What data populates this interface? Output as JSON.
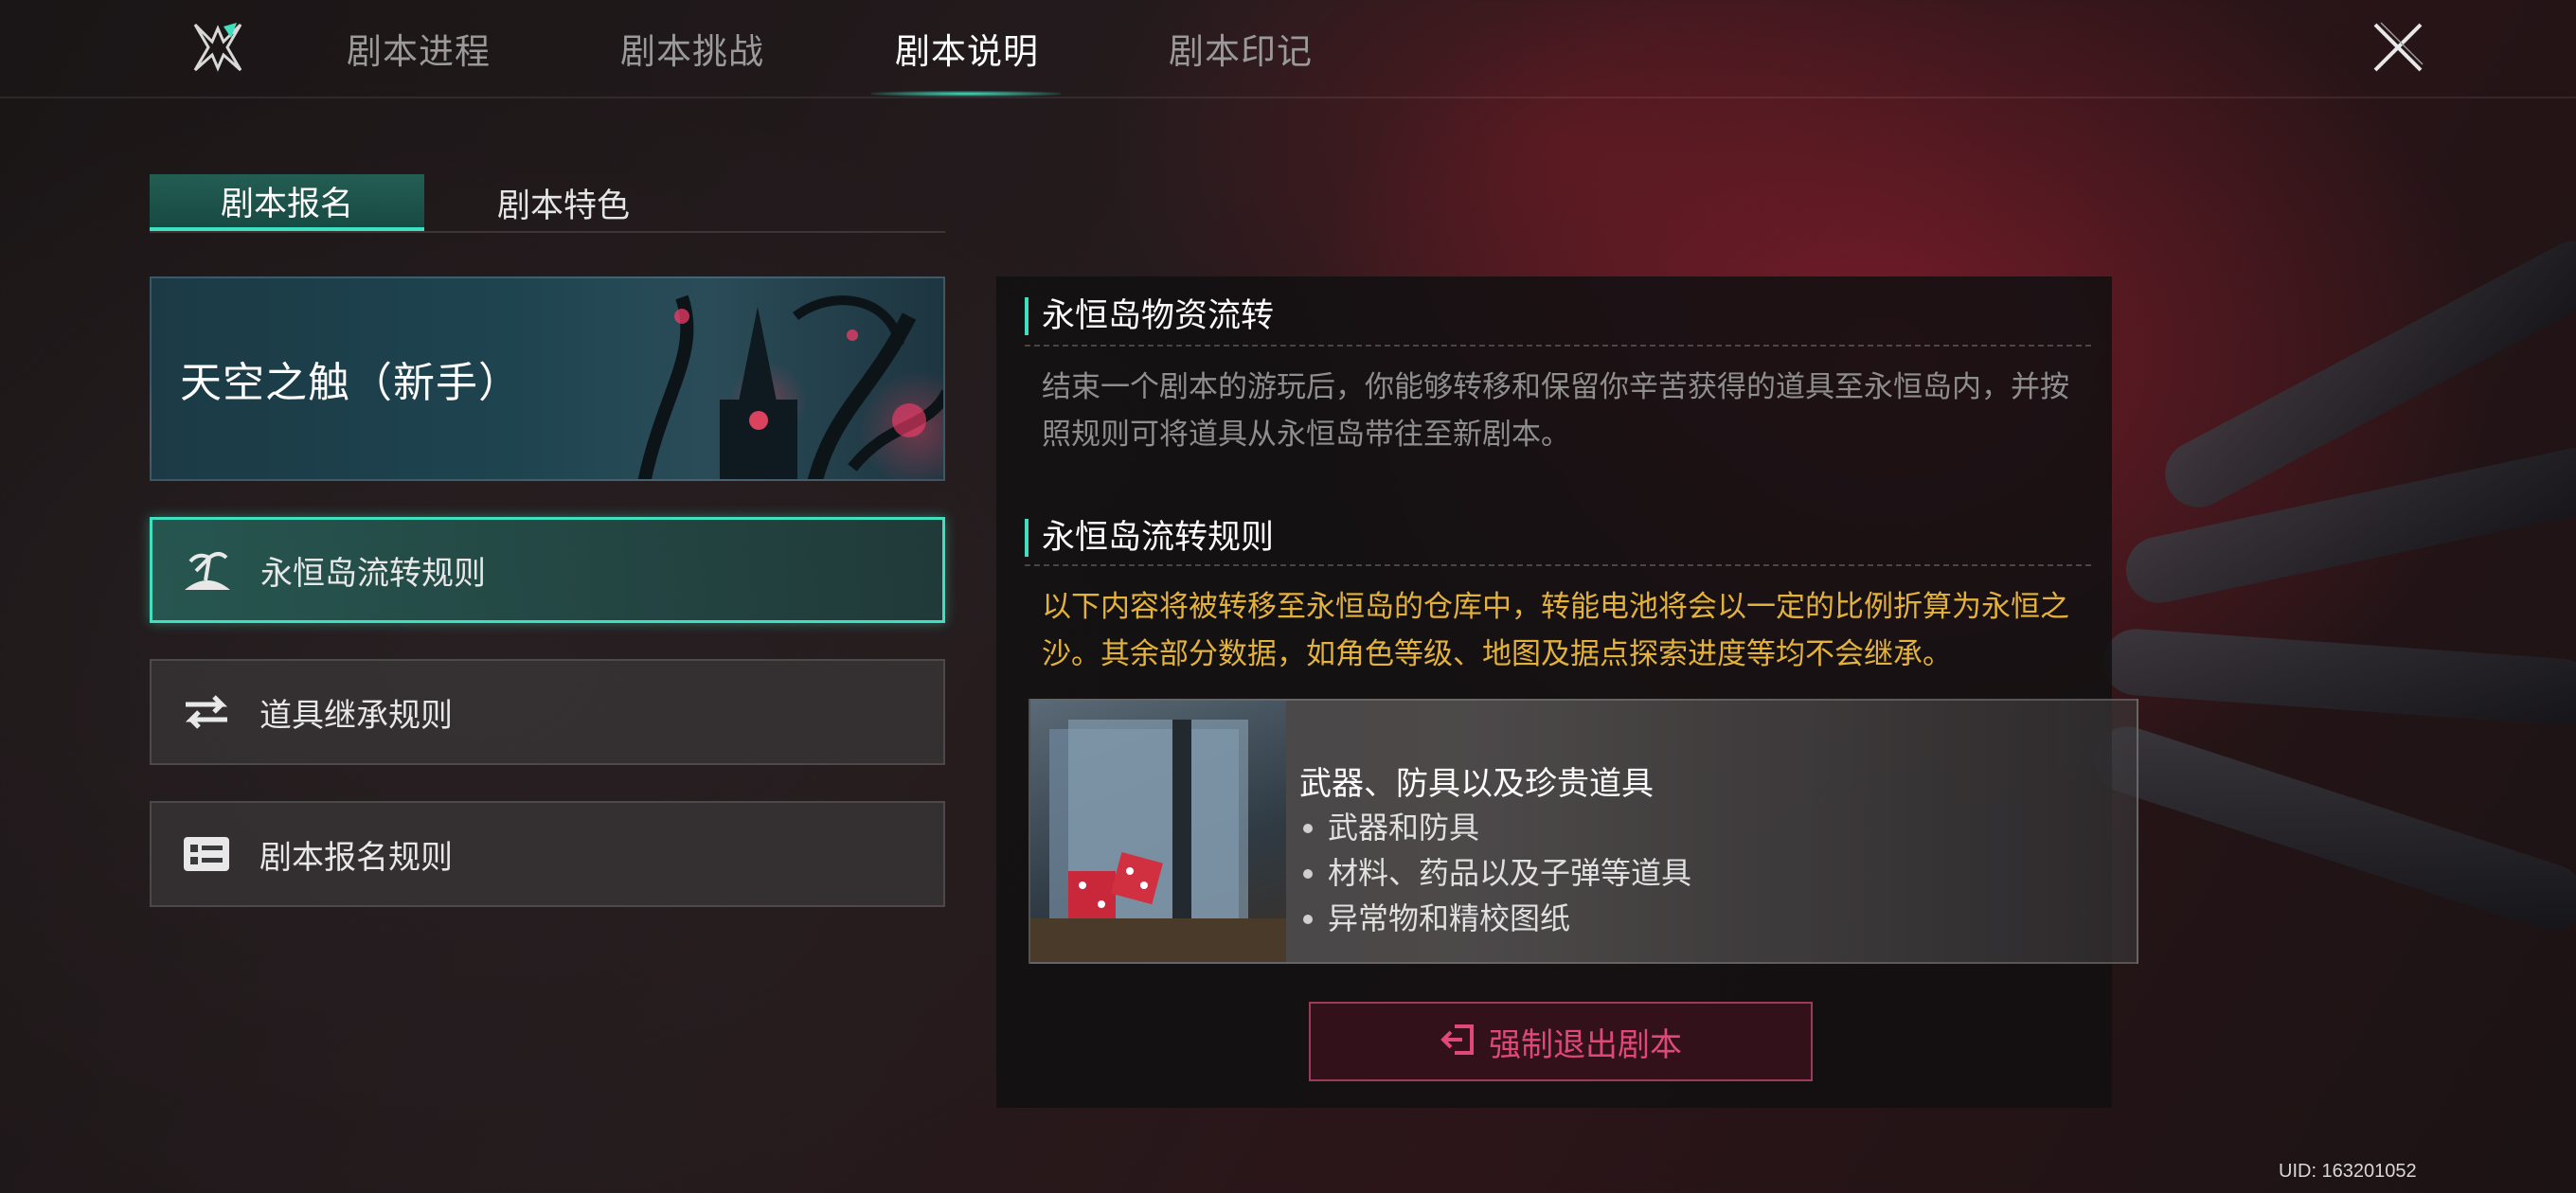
{
  "nav": {
    "tabs": [
      {
        "label": "剧本进程"
      },
      {
        "label": "剧本挑战"
      },
      {
        "label": "剧本说明"
      },
      {
        "label": "剧本印记"
      }
    ],
    "active_tab": "剧本说明"
  },
  "subtabs": [
    {
      "label": "剧本报名"
    },
    {
      "label": "剧本特色"
    }
  ],
  "banner": {
    "title": "天空之触（新手）"
  },
  "menu": [
    {
      "label": "永恒岛流转规则",
      "icon": "island-icon"
    },
    {
      "label": "道具继承规则",
      "icon": "transfer-arrows-icon"
    },
    {
      "label": "剧本报名规则",
      "icon": "id-card-icon"
    }
  ],
  "panel": {
    "section1": {
      "title": "永恒岛物资流转",
      "text": "结束一个剧本的游玩后，你能够转移和保留你辛苦获得的道具至永恒岛内，并按照规则可将道具从永恒岛带往至新剧本。"
    },
    "section2": {
      "title": "永恒岛流转规则",
      "text": "以下内容将被转移至永恒岛的仓库中，转能电池将会以一定的比例折算为永恒之沙。其余部分数据，如角色等级、地图及据点探索进度等均不会继承。"
    },
    "card": {
      "title": "武器、防具以及珍贵道具",
      "items": [
        "武器和防具",
        "材料、药品以及子弹等道具",
        "异常物和精校图纸"
      ]
    },
    "exit_button": "强制退出剧本"
  },
  "uid": "UID: 163201052",
  "colors": {
    "accent": "#3fe0c0",
    "warn": "#e3b23c",
    "danger": "#e0487a"
  }
}
